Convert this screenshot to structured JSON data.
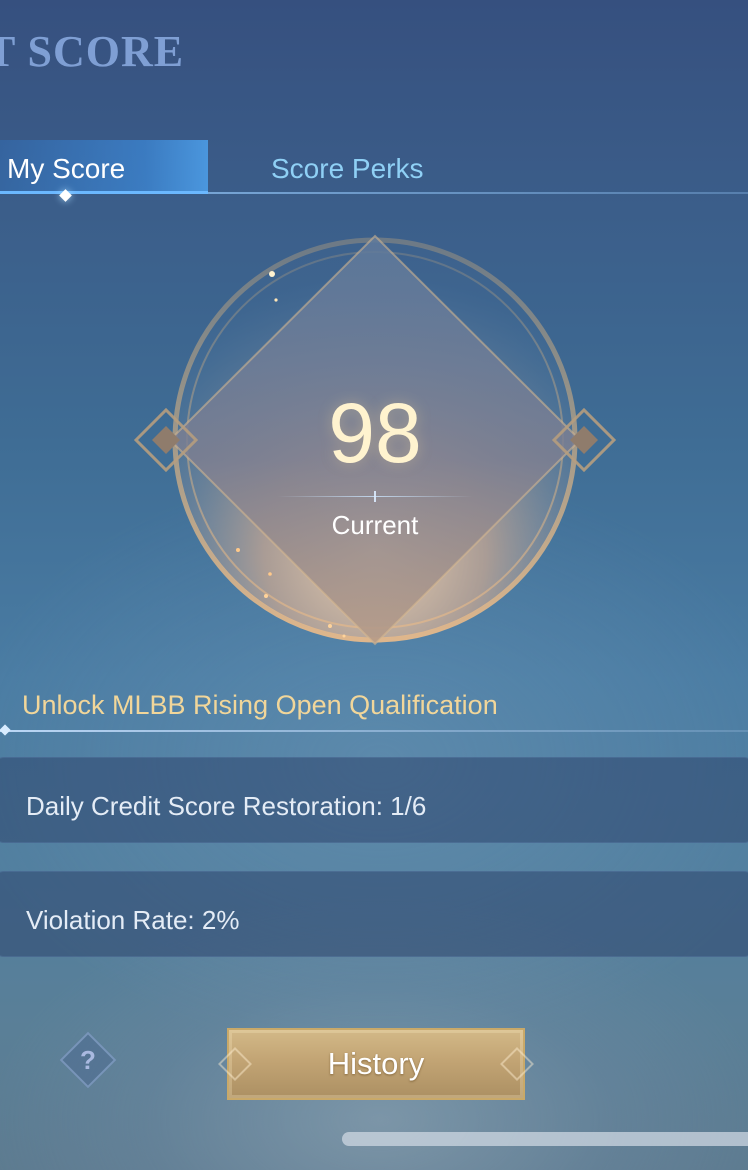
{
  "header": {
    "title": "T SCORE"
  },
  "tabs": [
    {
      "label": "My Score",
      "active": true
    },
    {
      "label": "Score Perks",
      "active": false
    }
  ],
  "score": {
    "value": "98",
    "label": "Current"
  },
  "qualification": {
    "text": "Unlock MLBB Rising Open Qualification"
  },
  "info": {
    "restoration": "Daily Credit Score Restoration: 1/6",
    "violation": "Violation Rate: 2%"
  },
  "footer": {
    "help_icon": "?",
    "history_label": "History"
  },
  "colors": {
    "accent_gold": "#f1d69a",
    "tab_active": "#6bb8ff",
    "tab_inactive": "#8fd0f5",
    "button_gold": "#c2a474"
  },
  "icons": {
    "help": "question-mark-icon",
    "emblem": "diamond-emblem-icon"
  }
}
